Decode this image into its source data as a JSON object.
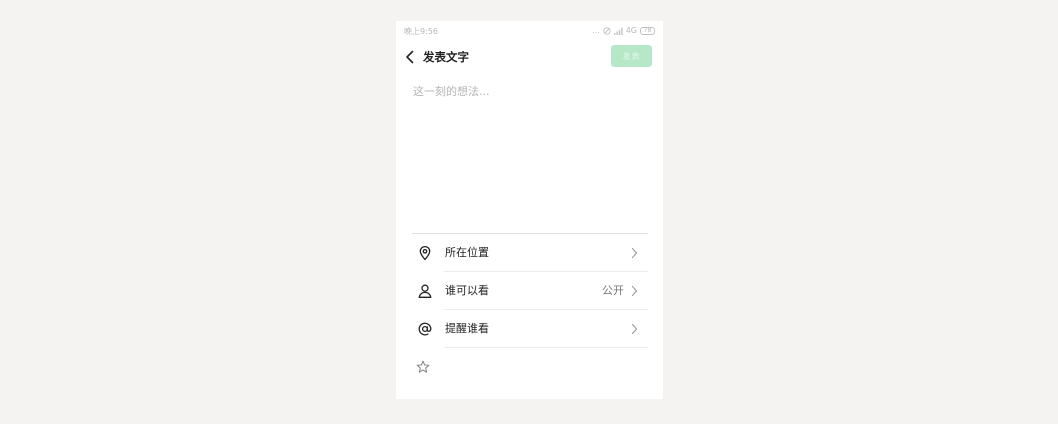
{
  "status_bar": {
    "time": "晚上9:56",
    "dots": "...",
    "network": "4G",
    "battery": "78"
  },
  "nav": {
    "back_icon": "chevron-left-icon",
    "title": "发表文字",
    "publish_label": "发表"
  },
  "compose": {
    "placeholder": "这一刻的想法..."
  },
  "options": [
    {
      "icon": "location-pin-icon",
      "label": "所在位置",
      "value": ""
    },
    {
      "icon": "person-icon",
      "label": "谁可以看",
      "value": "公开"
    },
    {
      "icon": "at-sign-icon",
      "label": "提醒谁看",
      "value": ""
    }
  ],
  "footer": {
    "star_icon": "star-icon"
  },
  "colors": {
    "page_background": "#f4f3f1",
    "publish_disabled": "#b6e8c8",
    "text_primary": "#222222",
    "placeholder": "#b4b4b4"
  }
}
